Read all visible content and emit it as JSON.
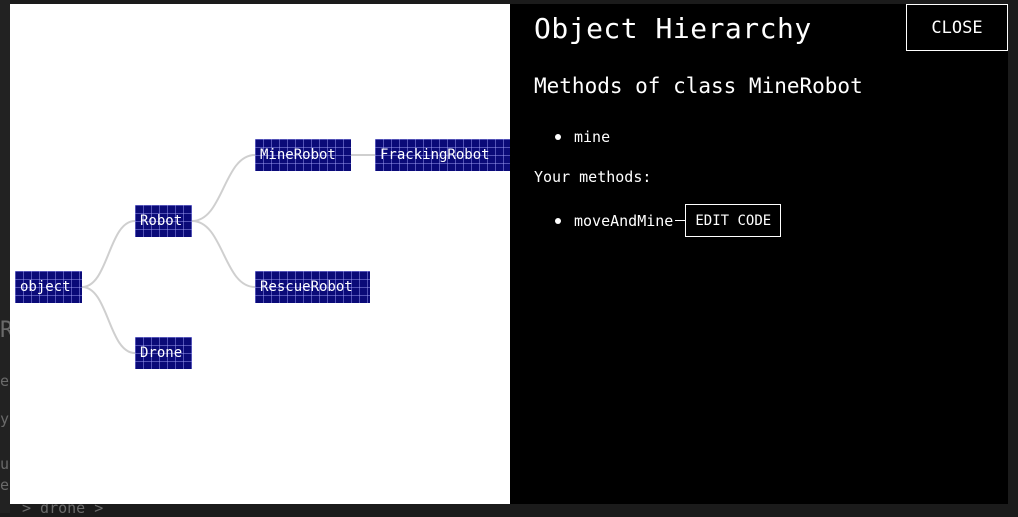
{
  "background": {
    "fragments": [
      "R",
      "e",
      "y",
      "ue",
      "e",
      "> drone >"
    ]
  },
  "modal": {
    "title": "Object Hierarchy",
    "close_label": "CLOSE",
    "class_heading": "Methods of class MineRobot",
    "methods": [
      "mine"
    ],
    "your_methods_label": "Your methods:",
    "your_methods": [
      {
        "name": "moveAndMine",
        "edit_label": "EDIT CODE"
      }
    ]
  },
  "hierarchy": {
    "nodes": {
      "object": "object",
      "robot": "Robot",
      "drone": "Drone",
      "minerobot": "MineRobot",
      "rescuerobot": "RescueRobot",
      "frackingrobot": "FrackingRobot"
    },
    "edges": [
      [
        "object",
        "robot"
      ],
      [
        "object",
        "drone"
      ],
      [
        "robot",
        "minerobot"
      ],
      [
        "robot",
        "rescuerobot"
      ],
      [
        "minerobot",
        "frackingrobot"
      ]
    ]
  },
  "colors": {
    "node_fill": "#0a0a78",
    "edge": "#cfcfcf",
    "panel": "#000000",
    "graph_bg": "#ffffff"
  }
}
